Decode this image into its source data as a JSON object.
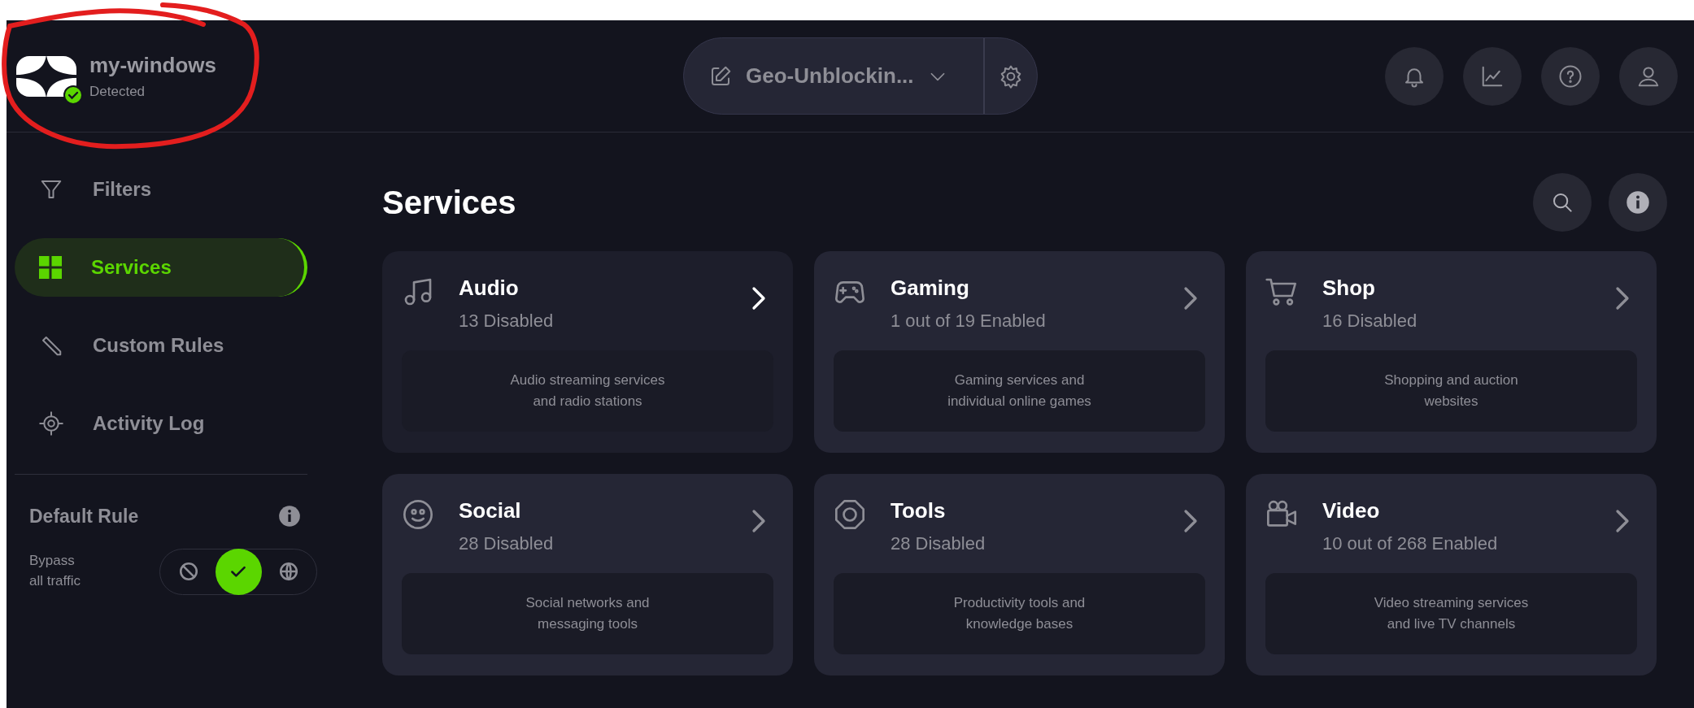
{
  "device": {
    "name": "my-windows",
    "status": "Detected",
    "detected": true
  },
  "profile": {
    "name": "Geo-Unblockin..."
  },
  "sidebar": {
    "items": [
      {
        "label": "Filters",
        "selected": false
      },
      {
        "label": "Services",
        "selected": true
      },
      {
        "label": "Custom Rules",
        "selected": false
      },
      {
        "label": "Activity Log",
        "selected": false
      }
    ]
  },
  "default_rule": {
    "title": "Default Rule",
    "label": "Bypass all traffic",
    "options": [
      {
        "selected": false
      },
      {
        "selected": true
      },
      {
        "selected": false
      }
    ]
  },
  "page": {
    "title": "Services"
  },
  "categories": [
    {
      "name": "Audio",
      "summary": "13 Disabled",
      "description": "Audio streaming services and radio stations",
      "highlighted": true
    },
    {
      "name": "Gaming",
      "summary": "1 out of 19 Enabled",
      "description": "Gaming services and individual online games",
      "highlighted": false
    },
    {
      "name": "Shop",
      "summary": "16 Disabled",
      "description": "Shopping and auction websites",
      "highlighted": false
    },
    {
      "name": "Social",
      "summary": "28 Disabled",
      "description": "Social networks and messaging tools",
      "highlighted": false
    },
    {
      "name": "Tools",
      "summary": "28 Disabled",
      "description": "Productivity tools and knowledge bases",
      "highlighted": false
    },
    {
      "name": "Video",
      "summary": "10 out of 268 Enabled",
      "description": "Video streaming services and live TV channels",
      "highlighted": false
    }
  ]
}
